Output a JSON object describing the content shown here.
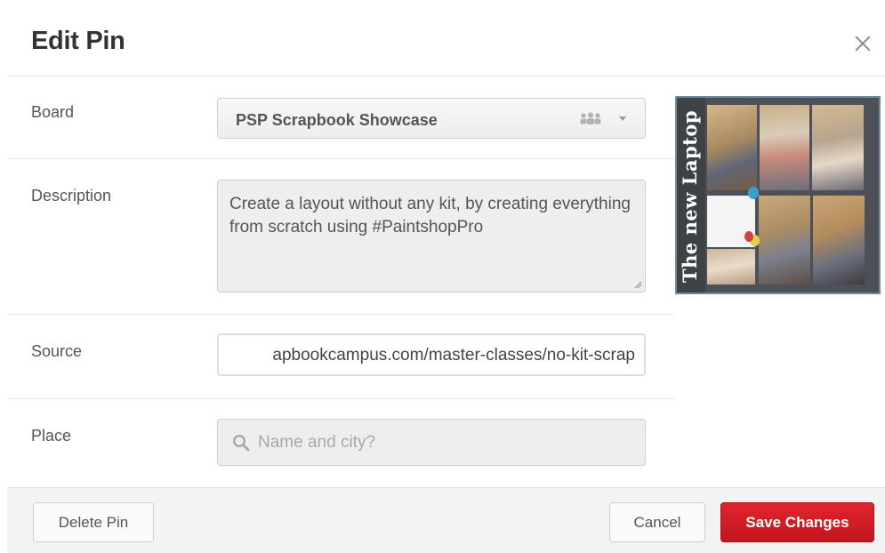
{
  "dialog": {
    "title": "Edit Pin",
    "close_icon": "close-icon"
  },
  "board": {
    "label": "Board",
    "value": "PSP Scrapbook Showcase",
    "icons": [
      "group-icon",
      "chevron-down-icon"
    ]
  },
  "description": {
    "label": "Description",
    "value": "Create a layout without any kit, by creating everything from scratch using #PaintshopPro"
  },
  "source": {
    "label": "Source",
    "value": "apbookcampus.com/master-classes/no-kit-scrap"
  },
  "place": {
    "label": "Place",
    "placeholder": "Name and city?",
    "icon": "search-icon"
  },
  "thumbnail": {
    "caption": "The new Laptop"
  },
  "footer": {
    "delete_label": "Delete Pin",
    "cancel_label": "Cancel",
    "save_label": "Save Changes"
  },
  "colors": {
    "save_button": "#cb1f27",
    "border": "#e6e6e6",
    "field_bg": "#eeeeee"
  }
}
